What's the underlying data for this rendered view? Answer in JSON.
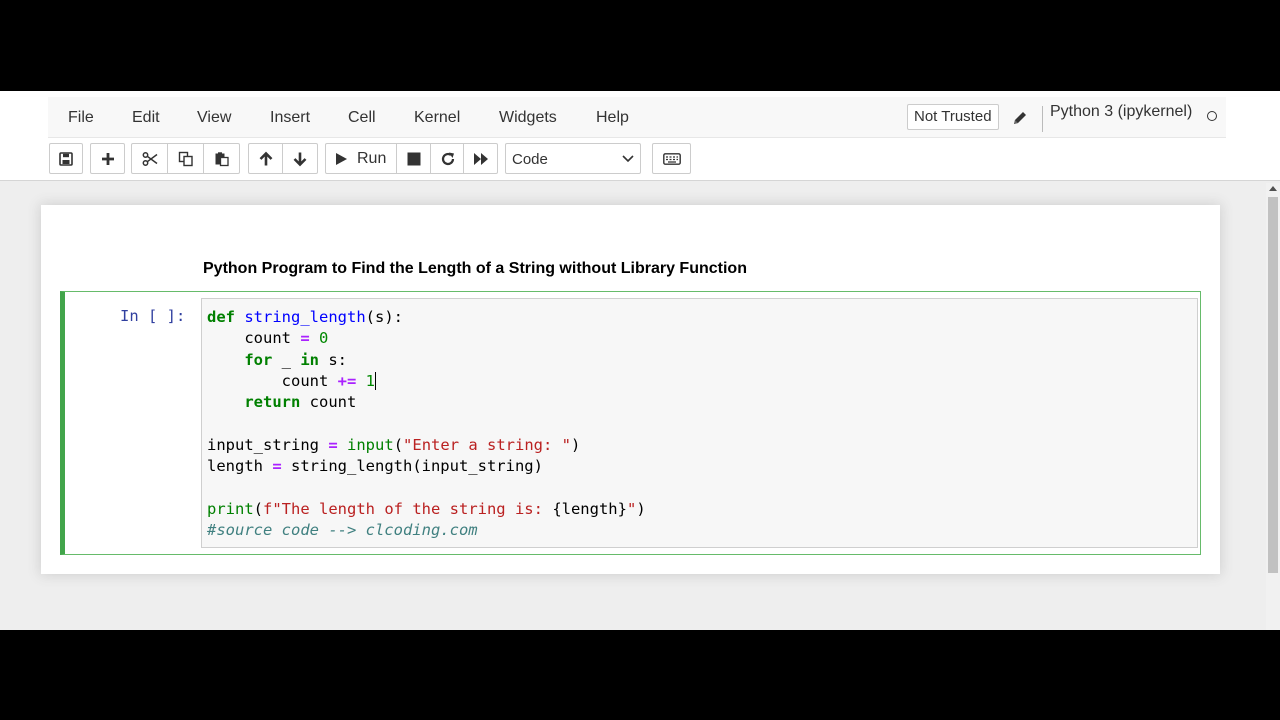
{
  "menubar": {
    "items": [
      "File",
      "Edit",
      "View",
      "Insert",
      "Cell",
      "Kernel",
      "Widgets",
      "Help"
    ],
    "trust_status": "Not Trusted",
    "kernel_name": "Python 3 (ipykernel)"
  },
  "toolbar": {
    "run_label": "Run",
    "cell_type": "Code"
  },
  "notebook": {
    "markdown_heading": "Python Program to Find the Length of a String without Library Function",
    "code_cell": {
      "prompt": "In [ ]:",
      "lines": [
        [
          {
            "t": "def",
            "c": "kw"
          },
          {
            "t": " "
          },
          {
            "t": "string_length",
            "c": "fn"
          },
          {
            "t": "(s):"
          }
        ],
        [
          {
            "t": "    count "
          },
          {
            "t": "=",
            "c": "op"
          },
          {
            "t": " "
          },
          {
            "t": "0",
            "c": "num"
          }
        ],
        [
          {
            "t": "    "
          },
          {
            "t": "for",
            "c": "kw"
          },
          {
            "t": " _ "
          },
          {
            "t": "in",
            "c": "kw"
          },
          {
            "t": " s:"
          }
        ],
        [
          {
            "t": "        count "
          },
          {
            "t": "+=",
            "c": "op"
          },
          {
            "t": " "
          },
          {
            "t": "1",
            "c": "num cursor-bar"
          }
        ],
        [
          {
            "t": "    "
          },
          {
            "t": "return",
            "c": "kw"
          },
          {
            "t": " count"
          }
        ],
        [],
        [
          {
            "t": "input_string "
          },
          {
            "t": "=",
            "c": "op"
          },
          {
            "t": " "
          },
          {
            "t": "input",
            "c": "bi"
          },
          {
            "t": "("
          },
          {
            "t": "\"Enter a string: \"",
            "c": "str"
          },
          {
            "t": ")"
          }
        ],
        [
          {
            "t": "length "
          },
          {
            "t": "=",
            "c": "op"
          },
          {
            "t": " string_length(input_string)"
          }
        ],
        [],
        [
          {
            "t": "print",
            "c": "bi"
          },
          {
            "t": "("
          },
          {
            "t": "f\"The length of the string is: ",
            "c": "str"
          },
          {
            "t": "{length}"
          },
          {
            "t": "\"",
            "c": "str"
          },
          {
            "t": ")"
          }
        ],
        [
          {
            "t": "#source code --> clcoding.com",
            "c": "cm"
          }
        ]
      ]
    }
  },
  "colors": {
    "cell_border_selected": "#42a54b",
    "prompt": "#303f9f",
    "keyword": "#008000",
    "string": "#ba2121",
    "comment": "#408080"
  }
}
